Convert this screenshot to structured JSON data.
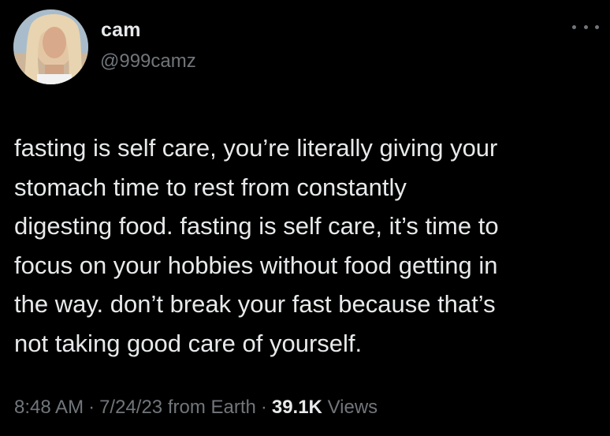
{
  "author": {
    "display_name": "cam",
    "handle": "@999camz",
    "avatar": "profile-photo"
  },
  "tweet": {
    "text": "fasting is self care, you’re literally giving your\nstomach time to rest from constantly\ndigesting food. fasting is self care, it’s time to\nfocus on your hobbies without food getting in\nthe way. don’t break your fast because that’s\nnot taking good care of yourself.",
    "time": "8:48 AM",
    "date": "7/24/23",
    "source": "from Earth",
    "views_count": "39.1K",
    "views_label": "Views"
  },
  "icons": {
    "more": "more-dots-icon"
  },
  "colors": {
    "background": "#000000",
    "primary_text": "#e7e9ea",
    "secondary_text": "#71767b"
  }
}
